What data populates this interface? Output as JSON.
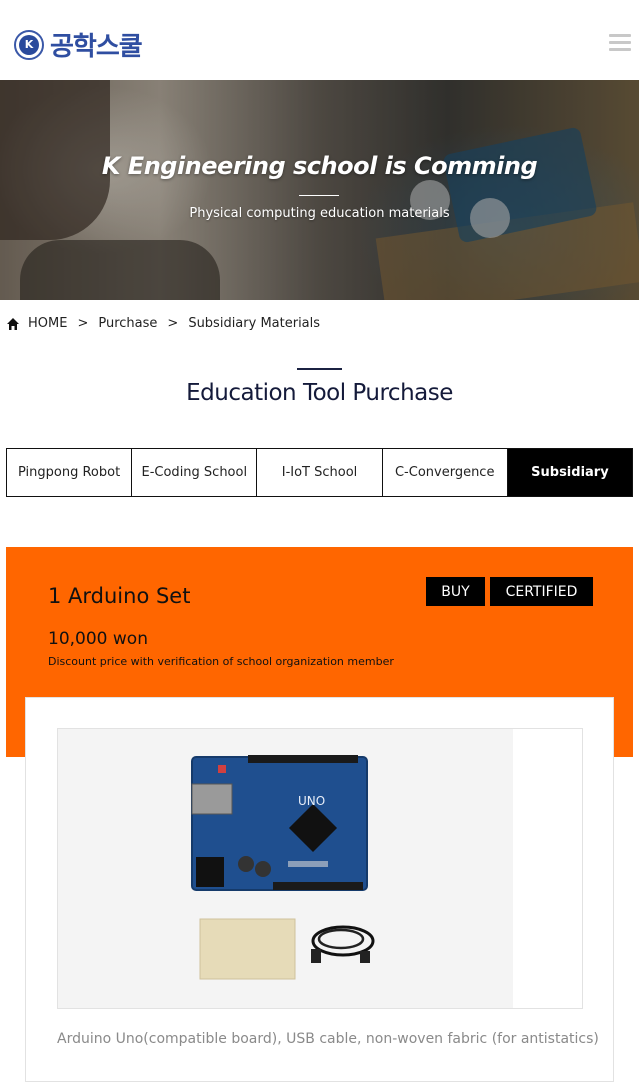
{
  "header": {
    "logo_emblem_letter": "K",
    "logo_text": "공학스쿨",
    "menu_icon": "hamburger-menu-icon"
  },
  "hero": {
    "title": "K Engineering school is Comming",
    "subtitle": "Physical computing education materials"
  },
  "breadcrumb": {
    "home_icon": "home-icon",
    "items": [
      "HOME",
      "Purchase",
      "Subsidiary Materials"
    ],
    "separator": ">"
  },
  "section": {
    "title": "Education Tool Purchase"
  },
  "tabs": [
    {
      "label": "Pingpong Robot",
      "active": false
    },
    {
      "label": "E-Coding School",
      "active": false
    },
    {
      "label": "I-IoT School",
      "active": false
    },
    {
      "label": "C-Convergence",
      "active": false
    },
    {
      "label": "Subsidiary",
      "active": true
    }
  ],
  "product": {
    "name": "1 Arduino Set",
    "buy_label": "BUY",
    "certified_label": "CERTIFIED",
    "price": "10,000 won",
    "discount_note": "Discount price with verification of school organization member",
    "board_text": "UNO",
    "caption": "Arduino Uno(compatible board), USB cable, non-woven fabric (for antistatics)"
  },
  "colors": {
    "accent": "#ff6600",
    "tab_active": "#000000",
    "title_navy": "#141a3a",
    "logo_blue": "#2f4ea1"
  }
}
